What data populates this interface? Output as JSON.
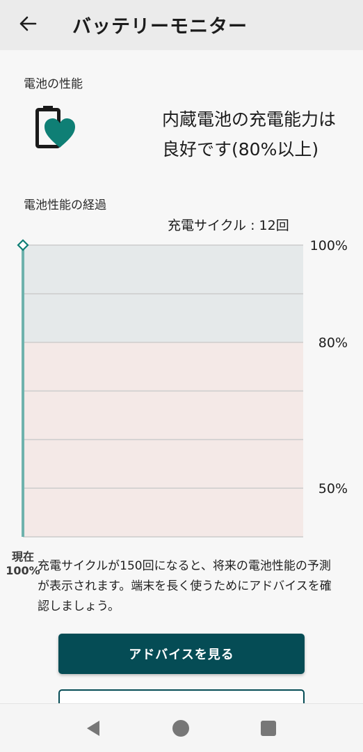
{
  "appbar": {
    "title": "バッテリーモニター",
    "back_icon": "arrow-left-icon"
  },
  "performance": {
    "section_label": "電池の性能",
    "icon": "battery-heart-icon",
    "status_line1": "内蔵電池の充電能力は",
    "status_line2": "良好です(80%以上)"
  },
  "trend": {
    "section_label": "電池性能の経過",
    "cycle_text": "充電サイクル : 12回"
  },
  "chart_data": {
    "type": "line",
    "title": "",
    "xlabel": "",
    "ylabel": "",
    "ylim": [
      40,
      100
    ],
    "yticks": [
      "100%",
      "80%",
      "50%"
    ],
    "ytick_values": [
      100,
      80,
      50
    ],
    "grid": true,
    "zones": [
      {
        "from": 80,
        "to": 100,
        "color": "#e5e9ea"
      },
      {
        "from": 40,
        "to": 80,
        "color": "#f4e9e7"
      }
    ],
    "series": [
      {
        "values": [
          100
        ],
        "color": "#6fb2ad"
      }
    ],
    "current_label_line1": "現在",
    "current_label_line2": "100%"
  },
  "info": {
    "text": "充電サイクルが150回になると、将来の電池性能の予測が表示されます。端末を長く使うためにアドバイスを確認しましょう。"
  },
  "buttons": {
    "advice_label": "アドバイスを見る"
  },
  "navbar": {
    "back_icon": "triangle-back-icon",
    "home_icon": "circle-home-icon",
    "recents_icon": "square-recents-icon"
  },
  "colors": {
    "accent": "#054c55",
    "heart": "#0f7f75",
    "line": "#6fb2ad"
  }
}
